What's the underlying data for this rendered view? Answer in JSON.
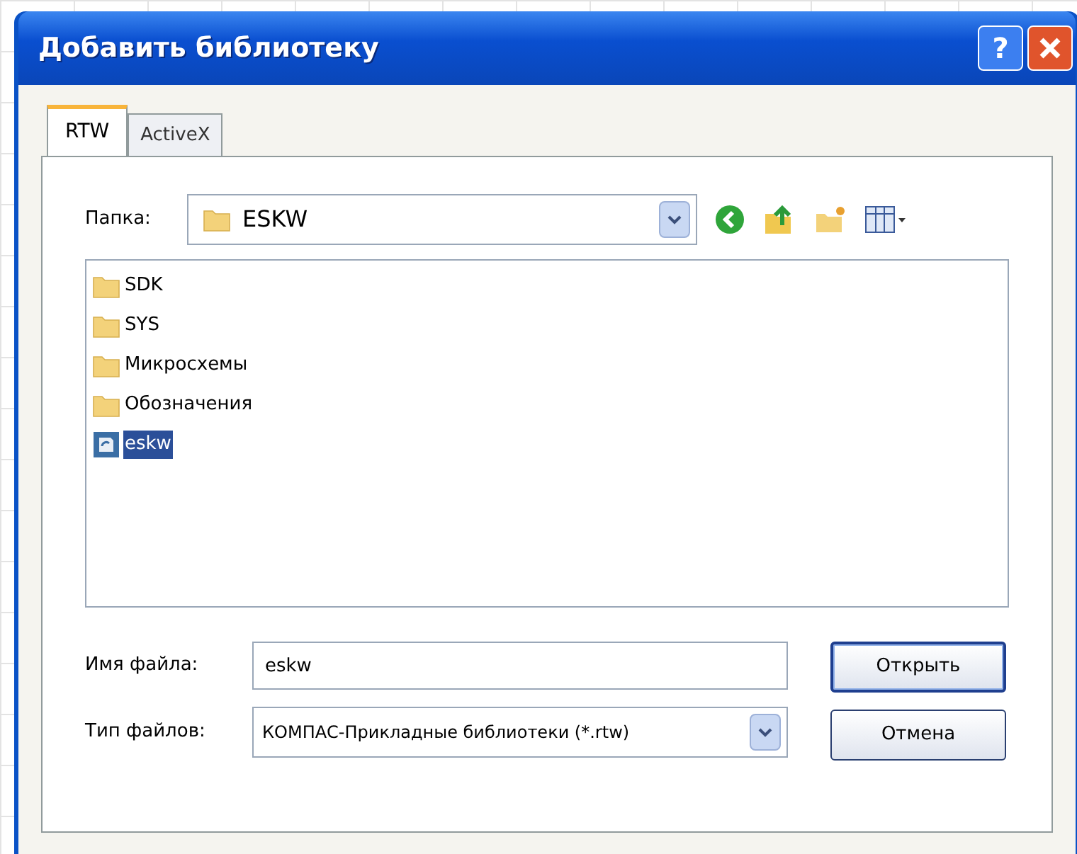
{
  "window": {
    "title": "Добавить библиотеку",
    "help": "?"
  },
  "tabs": [
    {
      "label": "RTW",
      "selected": true
    },
    {
      "label": "ActiveX",
      "selected": false
    }
  ],
  "folder": {
    "label": "Папка:",
    "value": "ESKW"
  },
  "files": [
    {
      "name": "SDK",
      "kind": "folder",
      "selected": false
    },
    {
      "name": "SYS",
      "kind": "folder",
      "selected": false
    },
    {
      "name": "Микросхемы",
      "kind": "folder",
      "selected": false
    },
    {
      "name": "Обозначения",
      "kind": "folder",
      "selected": false
    },
    {
      "name": "eskw",
      "kind": "library",
      "selected": true
    }
  ],
  "file_name": {
    "label": "Имя файла:",
    "value": "eskw"
  },
  "file_type": {
    "label": "Тип файлов:",
    "value": "КОМПАС-Прикладные библиотеки (*.rtw)"
  },
  "buttons": [
    {
      "label": "Открыть",
      "default": true
    },
    {
      "label": "Отмена",
      "default": false
    }
  ]
}
